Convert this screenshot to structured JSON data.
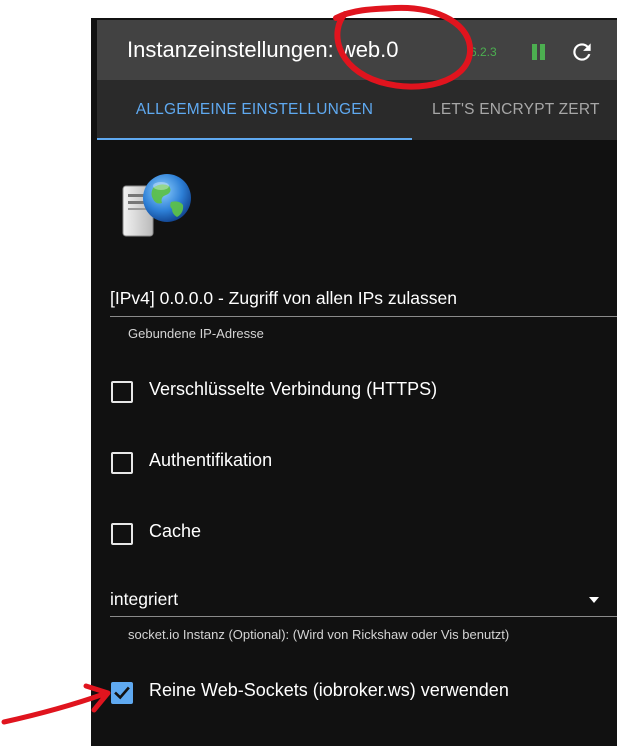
{
  "header": {
    "title": "Instanzeinstellungen: web.0",
    "version": "6.2.3"
  },
  "tabs": [
    {
      "label": "ALLGEMEINE EINSTELLUNGEN",
      "active": true
    },
    {
      "label": "LET'S ENCRYPT ZERT",
      "active": false
    }
  ],
  "ip_bind": {
    "value": "[IPv4] 0.0.0.0 - Zugriff von allen IPs zulassen",
    "helper": "Gebundene IP-Adresse"
  },
  "options": {
    "https": {
      "label": "Verschlüsselte Verbindung (HTTPS)",
      "checked": false
    },
    "auth": {
      "label": "Authentifikation",
      "checked": false
    },
    "cache": {
      "label": "Cache",
      "checked": false
    }
  },
  "socket": {
    "value": "integriert",
    "helper": "socket.io Instanz (Optional): (Wird von Rickshaw oder Vis benutzt)"
  },
  "websockets": {
    "label": "Reine Web-Sockets (iobroker.ws) verwenden",
    "checked": true
  },
  "colors": {
    "accent": "#5fa9f0",
    "running": "#4caf50",
    "annotation": "#e0141e",
    "header": "#424242",
    "background": "#111111"
  },
  "icons": [
    "server-globe-icon",
    "pause-icon",
    "reload-icon",
    "chevron-down-icon",
    "check-icon"
  ]
}
